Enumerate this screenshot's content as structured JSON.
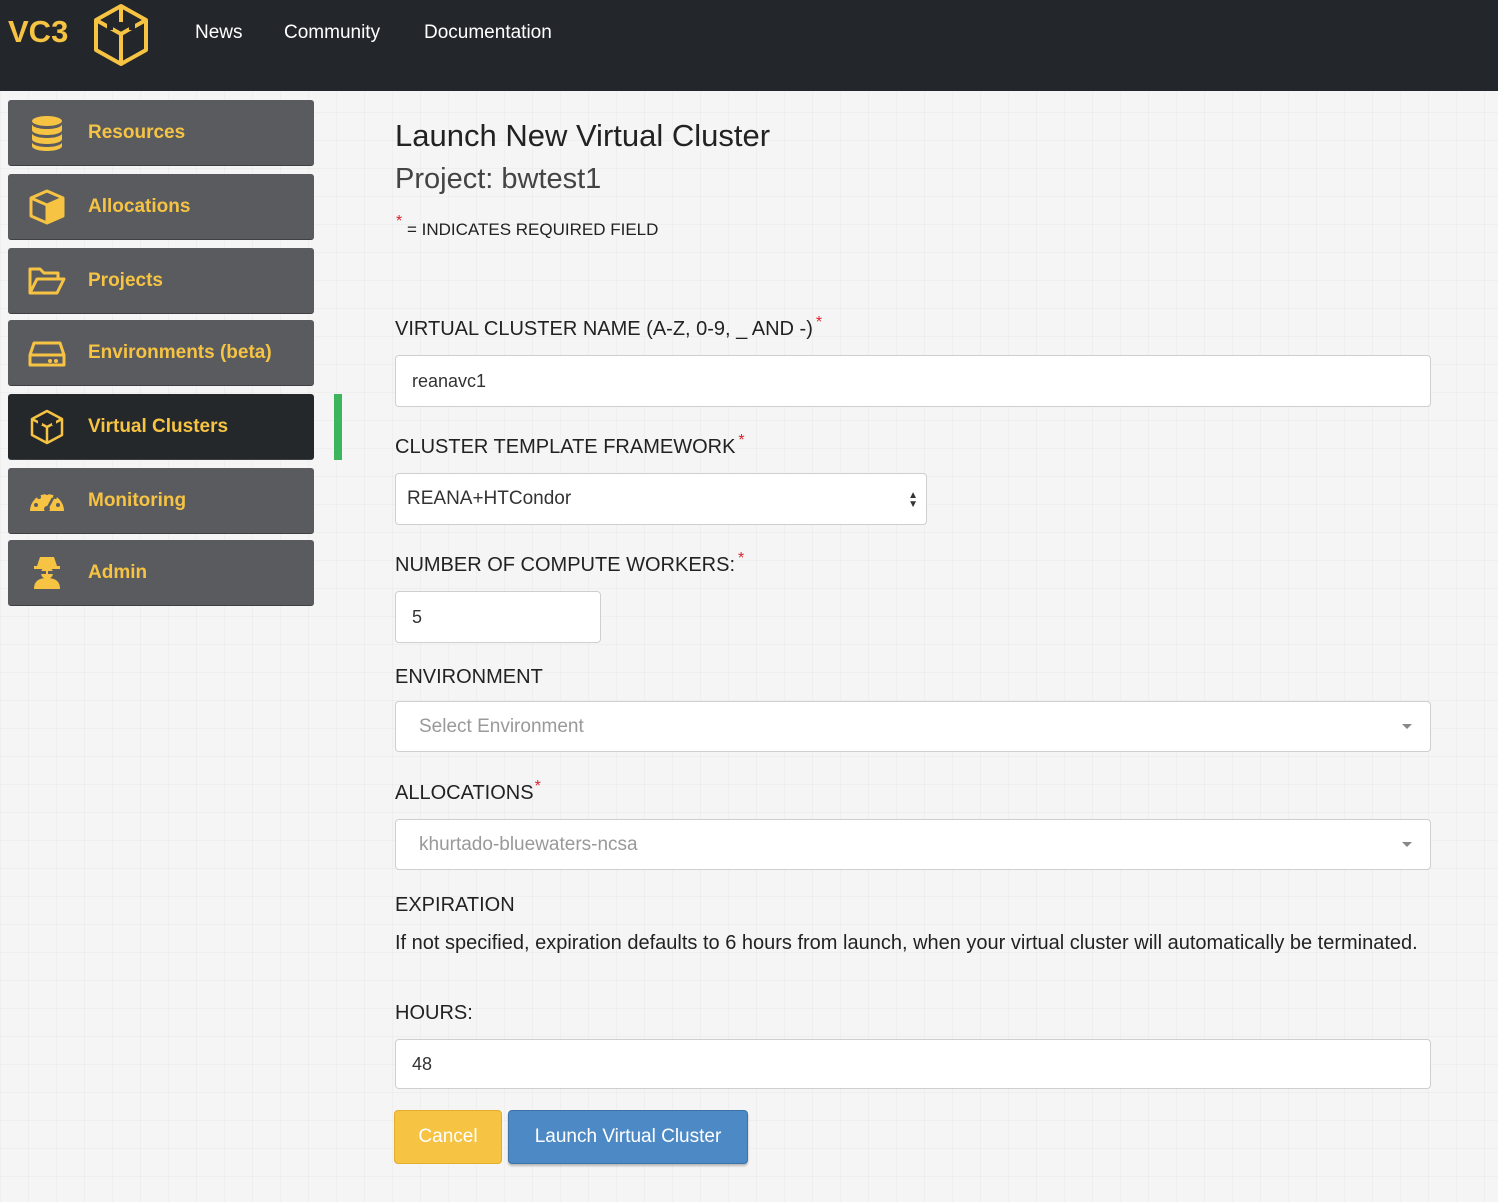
{
  "brand": {
    "name": "VC3",
    "logo": "hex-cube-logo"
  },
  "nav": {
    "links": [
      "News",
      "Community",
      "Documentation"
    ]
  },
  "sidebar": {
    "items": [
      {
        "label": "Resources",
        "icon": "database-icon"
      },
      {
        "label": "Allocations",
        "icon": "cube-icon"
      },
      {
        "label": "Projects",
        "icon": "folder-open-icon"
      },
      {
        "label": "Environments (beta)",
        "icon": "hard-drive-icon"
      },
      {
        "label": "Virtual Clusters",
        "icon": "hex-cube-icon",
        "active": true
      },
      {
        "label": "Monitoring",
        "icon": "gauge-icon"
      },
      {
        "label": "Admin",
        "icon": "user-secret-icon"
      }
    ]
  },
  "page": {
    "title": "Launch New Virtual Cluster",
    "subtitle": "Project: bwtest1",
    "required_star": "*",
    "required_note": "= INDICATES REQUIRED FIELD"
  },
  "form": {
    "name_label": "VIRTUAL CLUSTER NAME (A-Z, 0-9, _ AND -)",
    "name_value": "reanavc1",
    "framework_label": "CLUSTER TEMPLATE FRAMEWORK",
    "framework_value": "REANA+HTCondor",
    "workers_label": "NUMBER OF COMPUTE WORKERS:",
    "workers_value": "5",
    "environment_label": "ENVIRONMENT",
    "environment_placeholder": "Select Environment",
    "allocations_label": "ALLOCATIONS",
    "allocations_value": "khurtado-bluewaters-ncsa",
    "expiration_label": "EXPIRATION",
    "expiration_text": "If not specified, expiration defaults to 6 hours from launch, when your virtual cluster will automatically be terminated.",
    "hours_label": "HOURS:",
    "hours_value": "48",
    "cancel_label": "Cancel",
    "launch_label": "Launch Virtual Cluster"
  },
  "colors": {
    "topbar": "#23272b",
    "accent": "#f6c343",
    "sidebar": "#5a5b5f",
    "sidebar_active": "#25282b",
    "active_marker": "#3cb55d",
    "primary": "#4d8ac5",
    "required": "#d9232d"
  }
}
